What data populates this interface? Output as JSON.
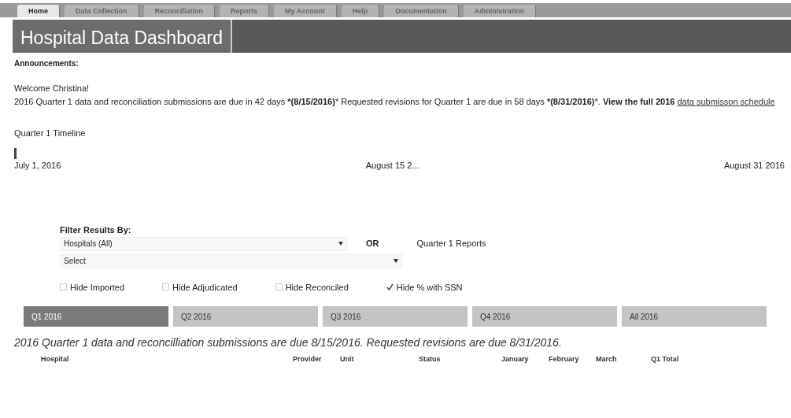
{
  "nav_tabs": [
    {
      "label": "Home",
      "selected": true
    },
    {
      "label": "Data Collection",
      "selected": false
    },
    {
      "label": "Reconciliation",
      "selected": false
    },
    {
      "label": "Reports",
      "selected": false
    },
    {
      "label": "My Account",
      "selected": false
    },
    {
      "label": "Help",
      "selected": false
    },
    {
      "label": "Documentation",
      "selected": false
    },
    {
      "label": "Administration",
      "selected": false
    }
  ],
  "title": "Hospital Data Dashboard",
  "announcements": {
    "heading": "Announcements:",
    "welcome": "Welcome Christina!",
    "message": "2016 Quarter 1 data and reconciliation submissions are due in 42 days ***(8/15/2016)***  Requested revisions for Quarter 1 are due in 58 days ***(8/31/2016)***. **View the full 2016**",
    "link": "data submisson schedule"
  },
  "timeline": {
    "title": "Quarter 1 Timeline",
    "level": 0.0,
    "labels": [
      "July 1, 2016",
      "August 15 2...",
      "August 31 2016"
    ]
  },
  "filter": {
    "heading": "Filter Results By:",
    "hospital_select": "Hospitals  (All)",
    "or_label": "OR",
    "reports_label": "Quarter 1  Reports",
    "second_select": "Select",
    "checkboxes": [
      {
        "label": "Hide Imported",
        "checked": false
      },
      {
        "label": "Hide Adjudicated",
        "checked": false
      },
      {
        "label": "Hide Reconciled",
        "checked": false
      },
      {
        "label": "Hide % with SSN",
        "checked": true
      }
    ]
  },
  "period_tabs": [
    {
      "label": "Q1 2016",
      "selected": true
    },
    {
      "label": "Q2 2016",
      "selected": false
    },
    {
      "label": "Q3 2016",
      "selected": false
    },
    {
      "label": "Q4 2016",
      "selected": false
    },
    {
      "label": "All 2016",
      "selected": false
    }
  ],
  "notice": "2016 Quarter 1 data and reconcilliation submissions are due 8/15/2016. Requested revisions are due 8/31/2016.",
  "table": {
    "columns": [
      "Hospital",
      "Provider",
      "Unit",
      "Status",
      "January",
      "February",
      "March",
      "Q1 Total"
    ]
  }
}
